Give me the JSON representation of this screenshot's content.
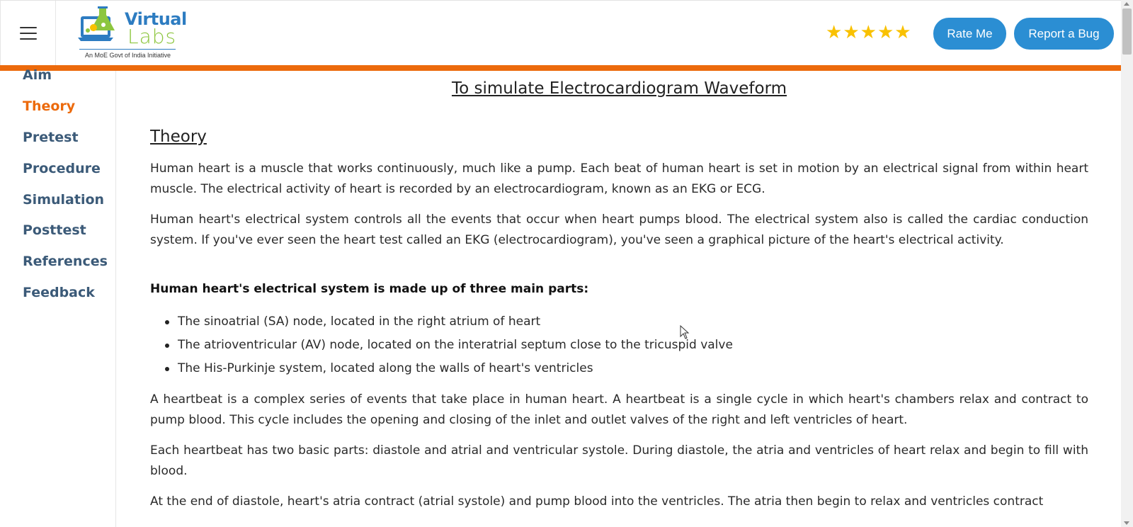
{
  "header": {
    "logo": {
      "word1": "Virtual",
      "word2": "Labs",
      "subtitle": "An MoE Govt of India Initiative"
    },
    "rating": {
      "value": 5,
      "max": 5,
      "star_color": "#f9c100"
    },
    "rate_button": "Rate Me",
    "bug_button": "Report a Bug"
  },
  "colors": {
    "accent_orange": "#ec6a0c",
    "button_blue": "#2b8ed3",
    "sidebar_text": "#3b5a78"
  },
  "sidebar": {
    "items": [
      {
        "label": "Aim",
        "active": false
      },
      {
        "label": "Theory",
        "active": true
      },
      {
        "label": "Pretest",
        "active": false
      },
      {
        "label": "Procedure",
        "active": false
      },
      {
        "label": "Simulation",
        "active": false
      },
      {
        "label": "Posttest",
        "active": false
      },
      {
        "label": "References",
        "active": false
      },
      {
        "label": "Feedback",
        "active": false
      }
    ]
  },
  "main": {
    "title": "To simulate Electrocardiogram Waveform",
    "section_title": "Theory",
    "para1": "Human heart is a muscle that works continuously, much like a pump. Each beat of human heart is set in motion by an electrical signal from within heart muscle. The electrical activity of heart is recorded by an electrocardiogram, known as an EKG or ECG.",
    "para2": "Human heart's electrical system controls all the events that occur when heart pumps blood. The electrical system also is called the cardiac conduction system. If you've ever seen the heart test called an EKG (electrocardiogram), you've seen a graphical picture of the heart's electrical activity.",
    "bold_para": "Human heart's electrical system is made up of three main parts:",
    "bullets": [
      "The sinoatrial (SA) node, located in the right atrium of heart",
      "The atrioventricular (AV) node, located on the interatrial septum close to the tricuspid valve",
      "The His-Purkinje system, located along the walls of heart's ventricles"
    ],
    "para3": "A heartbeat is a complex series of events that take place in human heart. A heartbeat is a single cycle in which heart's chambers relax and contract to pump blood. This cycle includes the opening and closing of the inlet and outlet valves of the right and left ventricles of heart.",
    "para4": "Each heartbeat has two basic parts: diastole and atrial and ventricular systole. During diastole, the atria and ventricles of heart relax and begin to fill with blood.",
    "para5": "At the end of diastole, heart's atria contract (atrial systole) and pump blood into the ventricles. The atria then begin to relax and ventricles contract"
  }
}
